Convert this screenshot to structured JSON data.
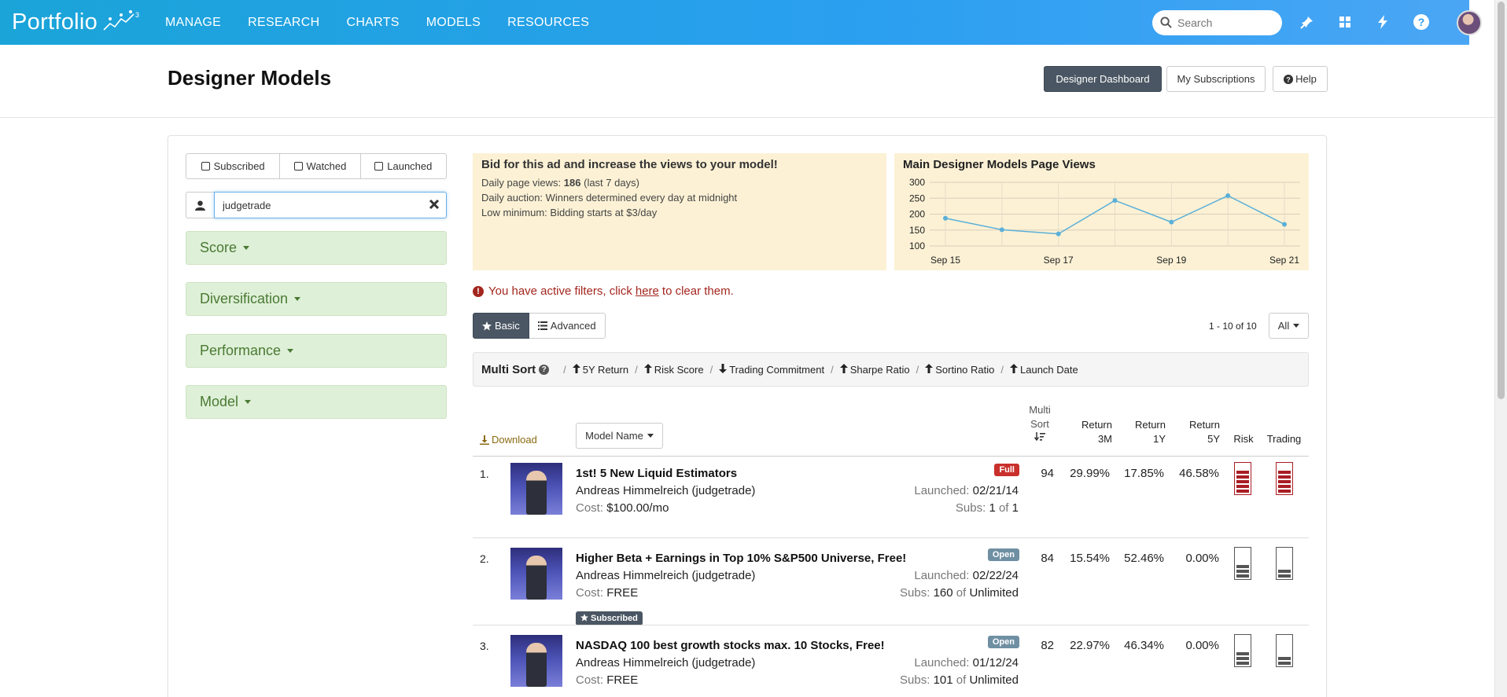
{
  "nav": {
    "logo": "Portfolio",
    "links": [
      "MANAGE",
      "RESEARCH",
      "CHARTS",
      "MODELS",
      "RESOURCES"
    ],
    "search_placeholder": "Search",
    "icons": [
      "pin-icon",
      "grid-icon",
      "bolt-icon",
      "help-circle-icon"
    ]
  },
  "header": {
    "title": "Designer Models",
    "buttons": [
      "Designer Dashboard",
      "My Subscriptions",
      "Help"
    ]
  },
  "sidebar": {
    "toggles": [
      "Subscribed",
      "Watched",
      "Launched"
    ],
    "user_filter_value": "judgetrade",
    "sections": [
      "Score",
      "Diversification",
      "Performance",
      "Model"
    ]
  },
  "ad": {
    "title": "Bid for this ad and increase the views to your model!",
    "line1_label": "Daily page views:",
    "line1_value": "186",
    "line1_suffix": "(last 7 days)",
    "line2": "Daily auction: Winners determined every day at midnight",
    "line3": "Low minimum: Bidding starts at $3/day"
  },
  "chart_data": {
    "type": "line",
    "title": "Main Designer Models Page Views",
    "x": [
      "Sep 15",
      "Sep 16",
      "Sep 17",
      "Sep 18",
      "Sep 19",
      "Sep 20",
      "Sep 21"
    ],
    "x_tick_labels": [
      "Sep 15",
      "Sep 17",
      "Sep 19",
      "Sep 21"
    ],
    "series": [
      {
        "values": [
          187,
          151,
          138,
          243,
          175,
          258,
          168
        ]
      }
    ],
    "y_ticks": [
      100,
      150,
      200,
      250,
      300
    ],
    "ylim": [
      100,
      300
    ],
    "grid": true,
    "color": "#5bb0d9"
  },
  "alert": {
    "before": "You have active filters, click",
    "link": "here",
    "after": "to clear them."
  },
  "view_tabs": [
    "Basic",
    "Advanced"
  ],
  "pager": {
    "range": "1 - 10 of 10",
    "page_size": "All"
  },
  "multisort": {
    "title": "Multi Sort",
    "items": [
      {
        "dir": "up",
        "label": "5Y Return"
      },
      {
        "dir": "up",
        "label": "Risk Score"
      },
      {
        "dir": "down",
        "label": "Trading Commitment"
      },
      {
        "dir": "up",
        "label": "Sharpe Ratio"
      },
      {
        "dir": "up",
        "label": "Sortino Ratio"
      },
      {
        "dir": "up",
        "label": "Launch Date"
      }
    ]
  },
  "table": {
    "download": "Download",
    "model_name_btn": "Model Name",
    "headers": {
      "multisort": [
        "Multi",
        "Sort"
      ],
      "ret3m": [
        "Return",
        "3M"
      ],
      "ret1y": [
        "Return",
        "1Y"
      ],
      "ret5y": [
        "Return",
        "5Y"
      ],
      "risk": "Risk",
      "trading": "Trading"
    },
    "labels": {
      "launched": "Launched:",
      "subs": "Subs:",
      "of": "of",
      "cost": "Cost:"
    },
    "rows": [
      {
        "rank": "1.",
        "name": "1st! 5 New Liquid Estimators",
        "author": "Andreas Himmelreich (judgetrade)",
        "cost": "$100.00/mo",
        "status": "Full",
        "launched": "02/21/14",
        "subs_n": "1",
        "subs_max": "1",
        "score": "94",
        "r3m": "29.99%",
        "r1y": "17.85%",
        "r5y": "46.58%",
        "risk": 5,
        "trading": 5,
        "subscribed": ""
      },
      {
        "rank": "2.",
        "name": "Higher Beta + Earnings in Top 10% S&P500 Universe, Free!",
        "author": "Andreas Himmelreich (judgetrade)",
        "cost": "FREE",
        "status": "Open",
        "launched": "02/22/24",
        "subs_n": "160",
        "subs_max": "Unlimited",
        "score": "84",
        "r3m": "15.54%",
        "r1y": "52.46%",
        "r5y": "0.00%",
        "risk": 3,
        "trading": 2,
        "subscribed": "Subscribed"
      },
      {
        "rank": "3.",
        "name": "NASDAQ 100 best growth stocks max. 10 Stocks, Free!",
        "author": "Andreas Himmelreich (judgetrade)",
        "cost": "FREE",
        "status": "Open",
        "launched": "01/12/24",
        "subs_n": "101",
        "subs_max": "Unlimited",
        "score": "82",
        "r3m": "22.97%",
        "r1y": "46.34%",
        "r5y": "0.00%",
        "risk": 3,
        "trading": 2,
        "subscribed": ""
      }
    ]
  }
}
